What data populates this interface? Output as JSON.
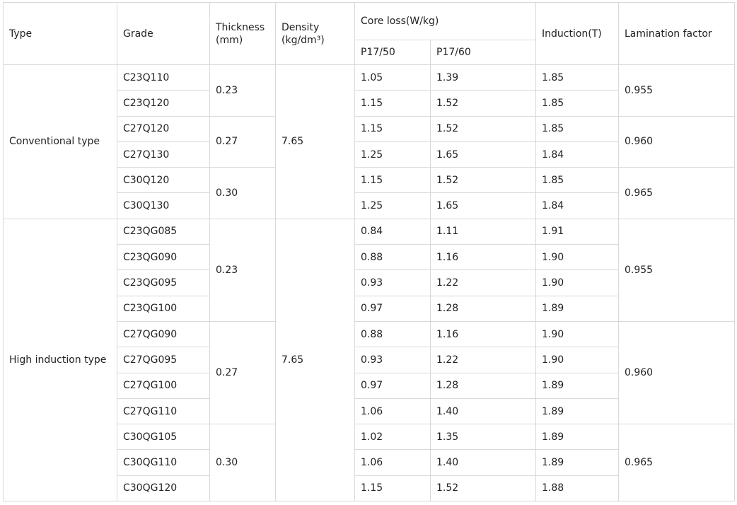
{
  "headers": {
    "type": "Type",
    "grade": "Grade",
    "thickness": "Thickness\n(mm)",
    "density": "Density\n(kg/dm³)",
    "core_loss": "Core loss(W/kg)",
    "p1750": "P17/50",
    "p1760": "P17/60",
    "induction": "Induction(T)",
    "lamination": "Lamination factor"
  },
  "groups": [
    {
      "type": "Conventional type",
      "density": "7.65",
      "thickness_groups": [
        {
          "thickness": "0.23",
          "lamination": "0.955",
          "rows": [
            {
              "grade": "C23Q110",
              "p1750": "1.05",
              "p1760": "1.39",
              "induction": "1.85"
            },
            {
              "grade": "C23Q120",
              "p1750": "1.15",
              "p1760": "1.52",
              "induction": "1.85"
            }
          ]
        },
        {
          "thickness": "0.27",
          "lamination": "0.960",
          "rows": [
            {
              "grade": "C27Q120",
              "p1750": "1.15",
              "p1760": "1.52",
              "induction": "1.85"
            },
            {
              "grade": "C27Q130",
              "p1750": "1.25",
              "p1760": "1.65",
              "induction": "1.84"
            }
          ]
        },
        {
          "thickness": "0.30",
          "lamination": "0.965",
          "rows": [
            {
              "grade": "C30Q120",
              "p1750": "1.15",
              "p1760": "1.52",
              "induction": "1.85"
            },
            {
              "grade": "C30Q130",
              "p1750": "1.25",
              "p1760": "1.65",
              "induction": "1.84"
            }
          ]
        }
      ]
    },
    {
      "type": "High induction type",
      "density": "7.65",
      "thickness_groups": [
        {
          "thickness": "0.23",
          "lamination": "0.955",
          "rows": [
            {
              "grade": "C23QG085",
              "p1750": "0.84",
              "p1760": "1.11",
              "induction": "1.91"
            },
            {
              "grade": "C23QG090",
              "p1750": "0.88",
              "p1760": "1.16",
              "induction": "1.90"
            },
            {
              "grade": "C23QG095",
              "p1750": "0.93",
              "p1760": "1.22",
              "induction": "1.90"
            },
            {
              "grade": "C23QG100",
              "p1750": "0.97",
              "p1760": "1.28",
              "induction": "1.89"
            }
          ]
        },
        {
          "thickness": "0.27",
          "lamination": "0.960",
          "rows": [
            {
              "grade": "C27QG090",
              "p1750": "0.88",
              "p1760": "1.16",
              "induction": "1.90"
            },
            {
              "grade": "C27QG095",
              "p1750": "0.93",
              "p1760": "1.22",
              "induction": "1.90"
            },
            {
              "grade": "C27QG100",
              "p1750": "0.97",
              "p1760": "1.28",
              "induction": "1.89"
            },
            {
              "grade": "C27QG110",
              "p1750": "1.06",
              "p1760": "1.40",
              "induction": "1.89"
            }
          ]
        },
        {
          "thickness": "0.30",
          "lamination": "0.965",
          "rows": [
            {
              "grade": "C30QG105",
              "p1750": "1.02",
              "p1760": "1.35",
              "induction": "1.89"
            },
            {
              "grade": "C30QG110",
              "p1750": "1.06",
              "p1760": "1.40",
              "induction": "1.89"
            },
            {
              "grade": "C30QG120",
              "p1750": "1.15",
              "p1760": "1.52",
              "induction": "1.88"
            }
          ]
        }
      ]
    }
  ]
}
